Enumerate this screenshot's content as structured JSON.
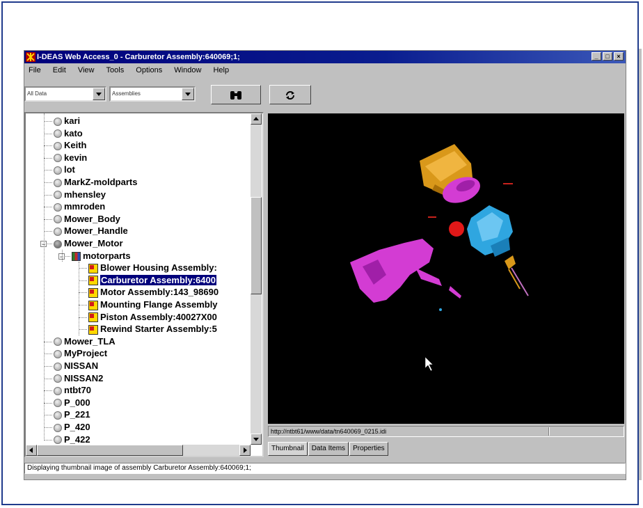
{
  "window": {
    "title": "I-DEAS Web Access_0 - Carburetor Assembly:640069;1;",
    "controls": [
      "_",
      "□",
      "×"
    ]
  },
  "menu": [
    "File",
    "Edit",
    "View",
    "Tools",
    "Options",
    "Window",
    "Help"
  ],
  "toolbar": {
    "filter_value": "All Data",
    "type_value": "Assemblies",
    "find_icon": "binoculars-icon",
    "refresh_icon": "refresh-icon"
  },
  "tree": {
    "items": [
      {
        "label": "kari",
        "icon": "globe"
      },
      {
        "label": "kato",
        "icon": "globe"
      },
      {
        "label": "Keith",
        "icon": "globe"
      },
      {
        "label": "kevin",
        "icon": "globe"
      },
      {
        "label": "lot",
        "icon": "globe"
      },
      {
        "label": "MarkZ-moldparts",
        "icon": "globe"
      },
      {
        "label": "mhensley",
        "icon": "globe"
      },
      {
        "label": "mmroden",
        "icon": "globe"
      },
      {
        "label": "Mower_Body",
        "icon": "globe"
      },
      {
        "label": "Mower_Handle",
        "icon": "globe"
      },
      {
        "label": "Mower_Motor",
        "icon": "globe-dark"
      },
      {
        "label": "motorparts",
        "icon": "library"
      },
      {
        "label": "Blower Housing Assembly:",
        "icon": "assembly"
      },
      {
        "label": "Carburetor Assembly:6400",
        "icon": "assembly"
      },
      {
        "label": "Motor Assembly:143_98690",
        "icon": "assembly"
      },
      {
        "label": "Mounting Flange Assembly",
        "icon": "assembly"
      },
      {
        "label": "Piston Assembly:40027X00",
        "icon": "assembly"
      },
      {
        "label": "Rewind Starter Assembly:5",
        "icon": "assembly"
      },
      {
        "label": "Mower_TLA",
        "icon": "globe"
      },
      {
        "label": "MyProject",
        "icon": "globe"
      },
      {
        "label": "NISSAN",
        "icon": "globe"
      },
      {
        "label": "NISSAN2",
        "icon": "globe"
      },
      {
        "label": "ntbt70",
        "icon": "globe"
      },
      {
        "label": "P_000",
        "icon": "globe"
      },
      {
        "label": "P_221",
        "icon": "globe"
      },
      {
        "label": "P_420",
        "icon": "globe"
      },
      {
        "label": "P_422",
        "icon": "globe"
      }
    ],
    "selected_index": 13
  },
  "viewer": {
    "url": "http://ntbt61/www/data/tn640069_0215.idi"
  },
  "tabs": [
    "Thumbnail",
    "Data Items",
    "Properties"
  ],
  "status": "Displaying thumbnail image of assembly Carburetor Assembly:640069;1;",
  "colors": {
    "titlebar": "#00007b",
    "selection": "#00007b",
    "part_orange": "#d99a1a",
    "part_magenta": "#d33cd3",
    "part_blue": "#2fa6e0",
    "part_red": "#e01818"
  }
}
